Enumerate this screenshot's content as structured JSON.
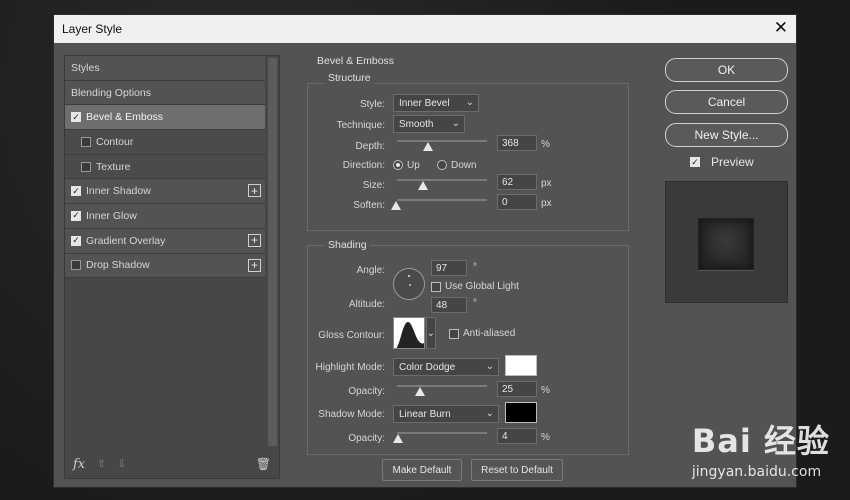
{
  "window": {
    "title": "Layer Style",
    "close": "✕"
  },
  "left": {
    "items": [
      {
        "label": "Styles",
        "checkbox": false,
        "checked": false,
        "sub": false,
        "plus": false,
        "active": false
      },
      {
        "label": "Blending Options",
        "checkbox": false,
        "checked": false,
        "sub": false,
        "plus": false,
        "active": false
      },
      {
        "label": "Bevel & Emboss",
        "checkbox": true,
        "checked": true,
        "sub": false,
        "plus": false,
        "active": true
      },
      {
        "label": "Contour",
        "checkbox": true,
        "checked": false,
        "sub": true,
        "plus": false,
        "active": false
      },
      {
        "label": "Texture",
        "checkbox": true,
        "checked": false,
        "sub": true,
        "plus": false,
        "active": false
      },
      {
        "label": "Inner Shadow",
        "checkbox": true,
        "checked": true,
        "sub": false,
        "plus": true,
        "active": false
      },
      {
        "label": "Inner Glow",
        "checkbox": true,
        "checked": true,
        "sub": false,
        "plus": false,
        "active": false
      },
      {
        "label": "Gradient Overlay",
        "checkbox": true,
        "checked": true,
        "sub": false,
        "plus": true,
        "active": false
      },
      {
        "label": "Drop Shadow",
        "checkbox": true,
        "checked": false,
        "sub": false,
        "plus": true,
        "active": false
      }
    ],
    "footer": {
      "fx": "fx",
      "up": "⇧",
      "down": "⇩",
      "trash": "🗑"
    }
  },
  "bevel": {
    "title": "Bevel & Emboss",
    "structure": {
      "title": "Structure",
      "style_label": "Style:",
      "style_value": "Inner Bevel",
      "technique_label": "Technique:",
      "technique_value": "Smooth",
      "depth_label": "Depth:",
      "depth_value": "368",
      "depth_unit": "%",
      "direction_label": "Direction:",
      "dir_up": "Up",
      "dir_down": "Down",
      "size_label": "Size:",
      "size_value": "62",
      "size_unit": "px",
      "soften_label": "Soften:",
      "soften_value": "0",
      "soften_unit": "px"
    },
    "shading": {
      "title": "Shading",
      "angle_label": "Angle:",
      "angle_value": "97",
      "angle_unit": "°",
      "global_light": "Use Global Light",
      "altitude_label": "Altitude:",
      "altitude_value": "48",
      "altitude_unit": "°",
      "gloss_label": "Gloss Contour:",
      "anti_aliased": "Anti-aliased",
      "highlight_label": "Highlight Mode:",
      "highlight_value": "Color Dodge",
      "highlight_color": "#ffffff",
      "opacity1_label": "Opacity:",
      "opacity1_value": "25",
      "opacity1_unit": "%",
      "shadow_label": "Shadow Mode:",
      "shadow_value": "Linear Burn",
      "shadow_color": "#000000",
      "opacity2_label": "Opacity:",
      "opacity2_value": "4",
      "opacity2_unit": "%"
    },
    "make_default": "Make Default",
    "reset_default": "Reset to Default"
  },
  "right": {
    "ok": "OK",
    "cancel": "Cancel",
    "new_style": "New Style...",
    "preview": "Preview"
  },
  "watermark": {
    "brand": "Bai 经验",
    "url": "jingyan.baidu.com"
  }
}
